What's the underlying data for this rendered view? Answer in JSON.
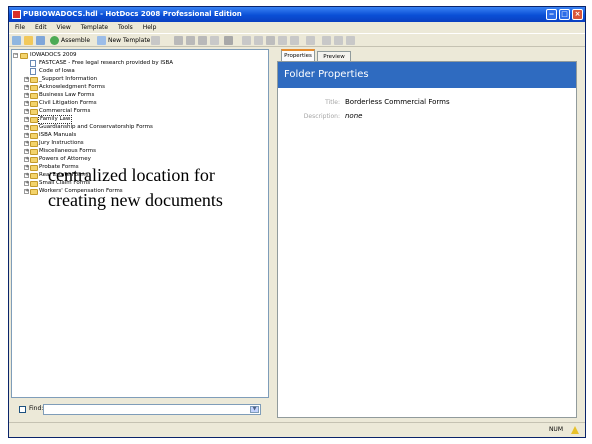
{
  "window": {
    "title": "PUBIOWADOCS.hdl - HotDocs 2008 Professional Edition",
    "controls": [
      "minimize",
      "maximize",
      "close"
    ]
  },
  "menu": [
    "File",
    "Edit",
    "View",
    "Template",
    "Tools",
    "Help"
  ],
  "toolbar": {
    "assemble": "Assemble",
    "new_template": "New Template"
  },
  "tree": {
    "root": "IOWADOCS 2009",
    "items": [
      "FASTCASE - Free legal research provided by ISBA",
      "Code of Iowa",
      "_Support Information",
      "Acknowledgment Forms",
      "Business Law Forms",
      "Civil Litigation Forms",
      "Commercial Forms",
      "Family Law",
      "Guardianship and Conservatorship Forms",
      "ISBA Manuals",
      "Jury Instructions",
      "Miscellaneous Forms",
      "Powers of Attorney",
      "Probate Forms",
      "Real Estate Forms",
      "Small Claim Forms",
      "Workers' Compensation Forms"
    ]
  },
  "find": {
    "label": "Find:",
    "value": ""
  },
  "tabs": [
    "Properties",
    "Preview"
  ],
  "panel": {
    "heading": "Folder Properties",
    "title_label": "Title:",
    "title_value": "Borderless Commercial Forms",
    "desc_label": "Description:",
    "desc_value": "none"
  },
  "overlay": {
    "line1": "centralized location for",
    "line2": "creating new documents"
  },
  "status": {
    "num": "NUM"
  },
  "colors": {
    "titlebar": "#0a4fd6",
    "panel_header": "#2f6bc0",
    "folder": "#f3d36b"
  }
}
